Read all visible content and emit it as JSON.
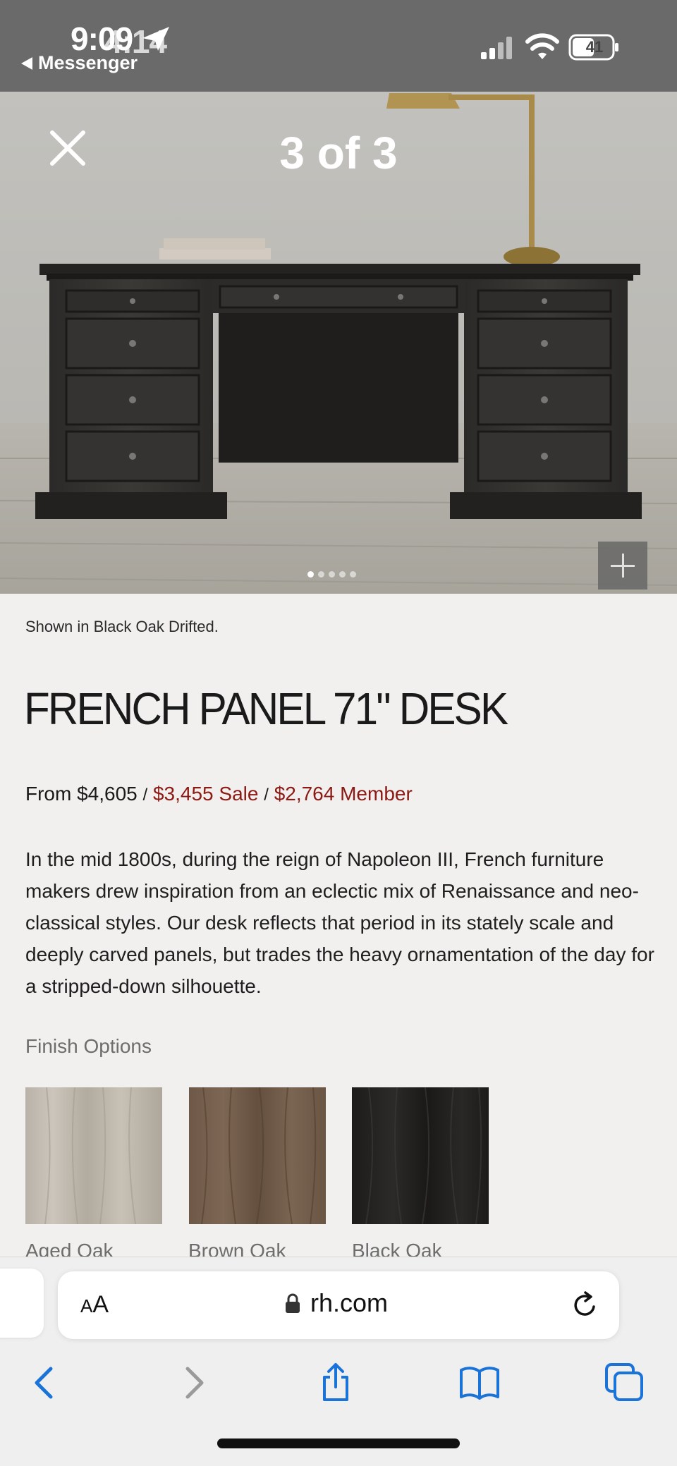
{
  "status_bar": {
    "time": "9:09",
    "time_overlap": "4:14",
    "back_app": "Messenger",
    "battery": "41"
  },
  "gallery": {
    "counter": "3 of 3",
    "dots": 5,
    "active_dot": 0
  },
  "product": {
    "caption": "Shown in Black Oak Drifted.",
    "title": "FRENCH PANEL 71\" DESK",
    "price_regular": "From $4,605",
    "price_sep": "/",
    "price_sale": "$3,455 Sale",
    "price_member": "$2,764 Member",
    "description": "In the mid 1800s, during the reign of Napoleon III, French furniture makers drew inspiration from an eclectic mix of Renaissance and neo-classical styles. Our desk reflects that period in its stately scale and deeply carved panels, but trades the heavy ornamentation of the day for a stripped-down silhouette.",
    "finish_label": "Finish Options",
    "finishes": [
      {
        "name": "Aged Oak",
        "color": "#bfb8ad"
      },
      {
        "name": "Brown Oak",
        "color": "#735d4b"
      },
      {
        "name": "Black Oak",
        "color": "#222120"
      }
    ]
  },
  "browser": {
    "aa_label": "AA",
    "url": "rh.com"
  },
  "colors": {
    "sale_red": "#8c1a14",
    "status_bar": "#6a6a6a",
    "ios_blue": "#1a73d9"
  }
}
